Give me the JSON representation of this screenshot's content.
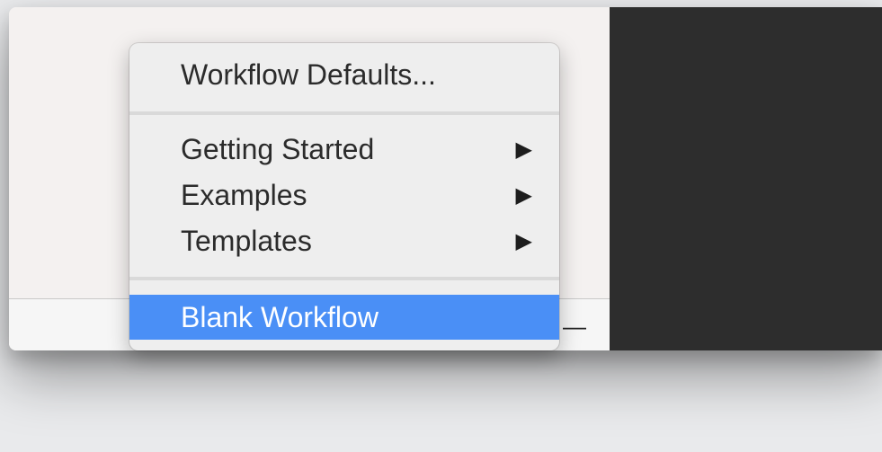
{
  "menu": {
    "items": [
      {
        "label": "Workflow Defaults..."
      },
      {
        "label": "Getting Started",
        "submenu_indicator": "▶"
      },
      {
        "label": "Examples",
        "submenu_indicator": "▶"
      },
      {
        "label": "Templates",
        "submenu_indicator": "▶"
      },
      {
        "label": "Blank Workflow",
        "selected": true
      }
    ]
  },
  "toolbar": {
    "remove_label": "—"
  },
  "colors": {
    "menu_background": "#eeeeee",
    "selection": "#4a8ff6",
    "dark_panel": "#2d2d2d",
    "window_background": "#f4f1f0"
  }
}
